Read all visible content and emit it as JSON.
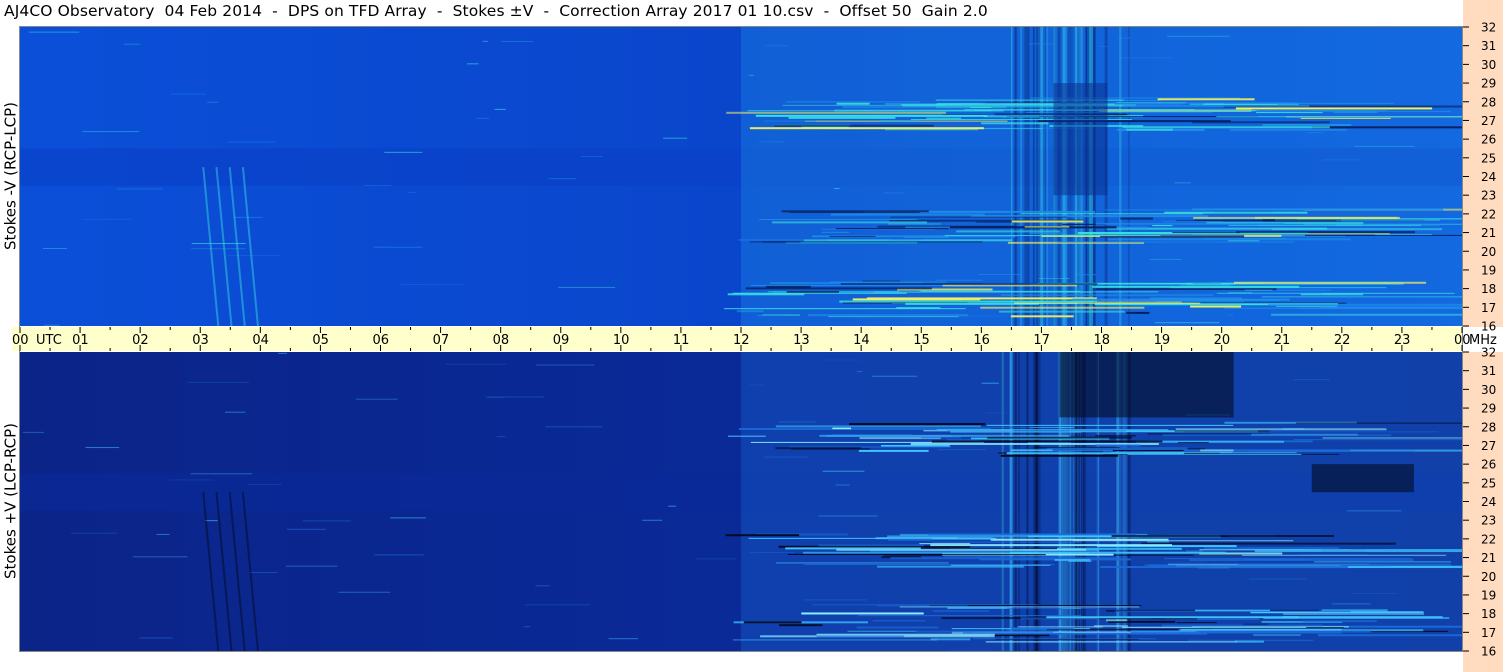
{
  "title": "AJ4CO Observatory  04 Feb 2014  -  DPS on TFD Array  -  Stokes ±V  -  Correction Array 2017 01 10.csv  -  Offset 50  Gain 2.0",
  "chart_data": [
    {
      "type": "heatmap",
      "name": "stokes-minus-v",
      "ylabel": "Stokes -V (RCP-LCP)",
      "x_unit": "UTC",
      "y_unit": "MHz",
      "xlim": [
        0,
        24
      ],
      "ylim": [
        16,
        32
      ],
      "x_ticks": [
        "00",
        "01",
        "02",
        "03",
        "04",
        "05",
        "06",
        "07",
        "08",
        "09",
        "10",
        "11",
        "12",
        "13",
        "14",
        "15",
        "16",
        "17",
        "18",
        "19",
        "20",
        "21",
        "22",
        "23",
        "00"
      ],
      "y_ticks": [
        16,
        17,
        18,
        19,
        20,
        21,
        22,
        23,
        24,
        25,
        26,
        27,
        28,
        29,
        30,
        31,
        32
      ],
      "colors": {
        "background": "#0b4fd8",
        "quiet": "#0a3fc7",
        "active": "#1f8fe8",
        "strong": "#38e0e0",
        "peak": "#f0f060"
      },
      "active_start_hour": 12
    },
    {
      "type": "heatmap",
      "name": "stokes-plus-v",
      "ylabel": "Stokes +V (LCP-RCP)",
      "x_unit": "UTC",
      "y_unit": "MHz",
      "xlim": [
        0,
        24
      ],
      "ylim": [
        16,
        32
      ],
      "x_ticks": [
        "00",
        "01",
        "02",
        "03",
        "04",
        "05",
        "06",
        "07",
        "08",
        "09",
        "10",
        "11",
        "12",
        "13",
        "14",
        "15",
        "16",
        "17",
        "18",
        "19",
        "20",
        "21",
        "22",
        "23",
        "00"
      ],
      "y_ticks": [
        16,
        17,
        18,
        19,
        20,
        21,
        22,
        23,
        24,
        25,
        26,
        27,
        28,
        29,
        30,
        31,
        32
      ],
      "colors": {
        "background": "#0b1f7a",
        "quiet": "#0a2a9a",
        "active": "#1a6ad8",
        "strong": "#40c8ff",
        "peak": "#8ff0ff"
      },
      "active_start_hour": 12
    }
  ],
  "axis_colors": {
    "time_bar": "#ffffcc",
    "freq_bar": "#ffdcc0"
  }
}
